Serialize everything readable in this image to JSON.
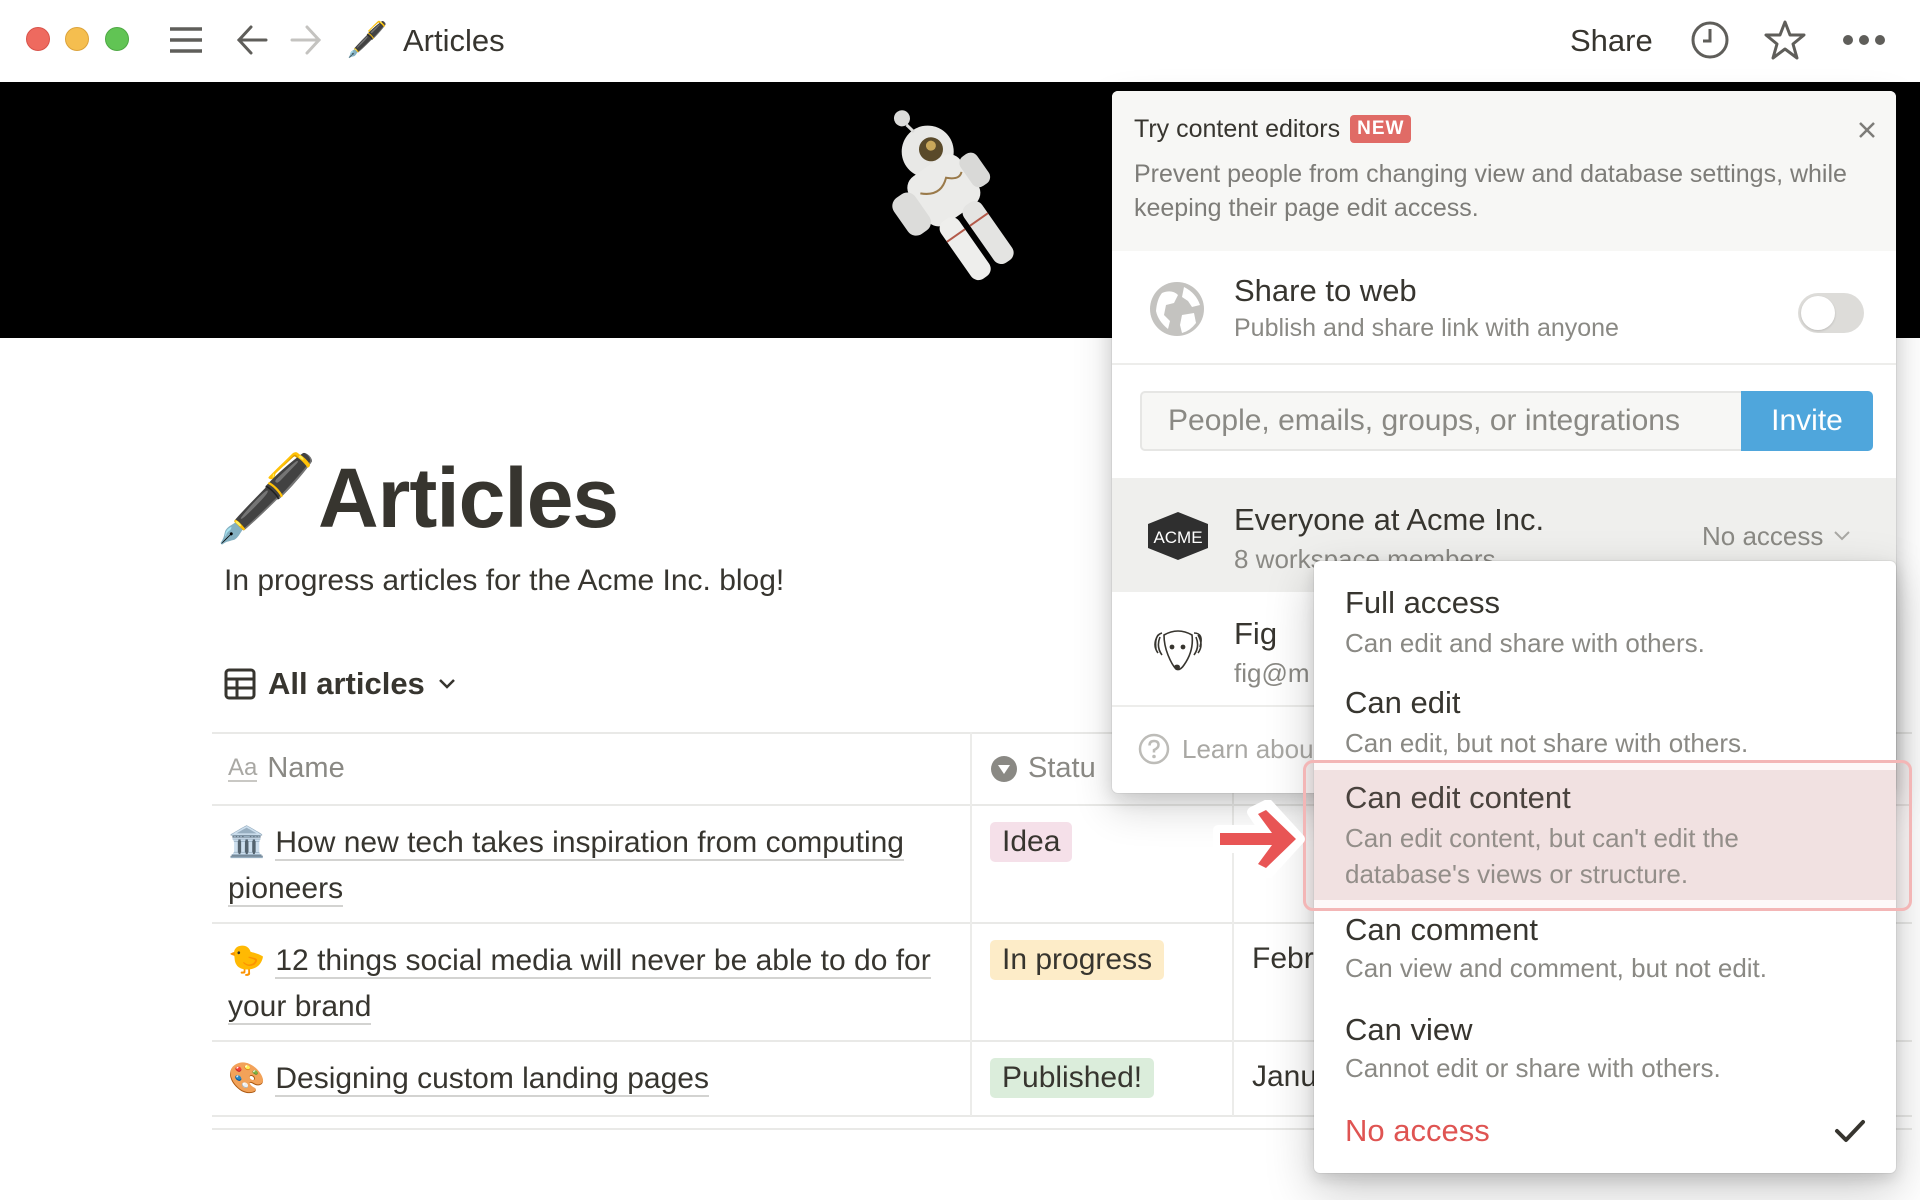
{
  "window": {
    "traffic_lights": [
      "close",
      "minimize",
      "zoom"
    ]
  },
  "topbar": {
    "breadcrumb_icon": "fountain-pen",
    "breadcrumb_emoji": "🖋️",
    "breadcrumb_title": "Articles",
    "share_label": "Share",
    "icons": [
      "menu-icon",
      "back-arrow-icon",
      "forward-arrow-icon",
      "clock-history-icon",
      "star-icon",
      "more-icon"
    ]
  },
  "page": {
    "cover": "astronaut-in-space",
    "emoji": "🖋️",
    "title": "Articles",
    "description": "In progress articles for the Acme Inc. blog!",
    "view": {
      "icon": "table-icon",
      "label": "All articles"
    },
    "table": {
      "columns": [
        {
          "icon": "text-aa-icon",
          "icon_text": "Aa",
          "label": "Name"
        },
        {
          "icon": "status-icon",
          "label": "Statu"
        }
      ],
      "rows": [
        {
          "emoji": "🏛️",
          "name": "How new tech takes inspiration from computing pioneers",
          "status": "Idea",
          "status_color": "#f5e0e9",
          "date": ""
        },
        {
          "emoji": "🐤",
          "name": "12 things social media will never be able to do for your brand",
          "status": "In progress",
          "status_color": "#fdecc8",
          "date": "Febr"
        },
        {
          "emoji": "🎨",
          "name": "Designing custom landing pages",
          "status": "Published!",
          "status_color": "#dbeddb",
          "date": "Janu"
        }
      ]
    }
  },
  "share_popover": {
    "promo": {
      "title": "Try content editors",
      "badge": "NEW",
      "badge_color": "#e06b66",
      "text": "Prevent people from changing view and database settings, while keeping their page edit access."
    },
    "share_to_web": {
      "title": "Share to web",
      "subtitle": "Publish and share link with anyone",
      "enabled": false
    },
    "invite": {
      "placeholder": "People, emails, groups, or integrations",
      "value": "",
      "button_label": "Invite",
      "button_color": "#4fa6dc"
    },
    "members": [
      {
        "avatar": "acme-logo",
        "avatar_text": "ACME",
        "name": "Everyone at Acme Inc.",
        "subtitle": "8 workspace members",
        "access": "No access"
      },
      {
        "avatar": "fig-dog-avatar",
        "name": "Fig",
        "subtitle": "fig@m"
      }
    ],
    "learn_link": "Learn abou"
  },
  "access_dropdown": {
    "options": [
      {
        "title": "Full access",
        "description": "Can edit and share with others."
      },
      {
        "title": "Can edit",
        "description": "Can edit, but not share with others."
      },
      {
        "title": "Can edit content",
        "description": "Can edit content, but can't edit the database's views or structure.",
        "highlighted": true
      },
      {
        "title": "Can comment",
        "description": "Can view and comment, but not edit."
      },
      {
        "title": "Can view",
        "description": "Cannot edit or share with others."
      },
      {
        "title": "No access",
        "description": "",
        "selected": true,
        "danger": true
      }
    ],
    "danger_color": "#df5452",
    "highlight_color": "#f3b6b6"
  }
}
